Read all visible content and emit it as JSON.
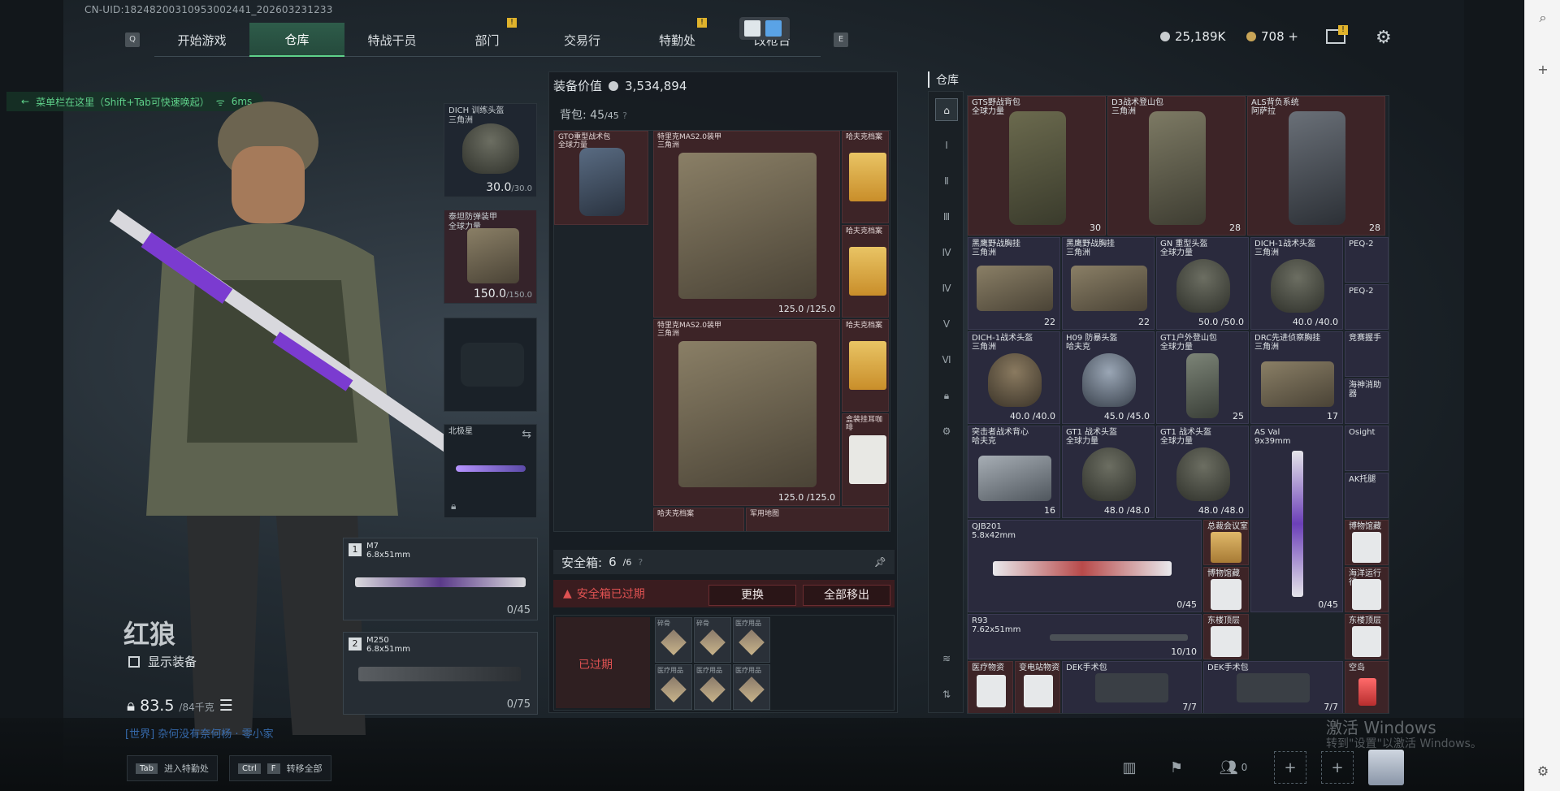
{
  "uid": "CN-UID:18248200310953002441_202603231233",
  "nav": {
    "left_key": "Q",
    "right_key": "E",
    "tabs": [
      {
        "label": "开始游戏",
        "alert": ""
      },
      {
        "label": "仓库",
        "alert": ""
      },
      {
        "label": "特战干员",
        "alert": ""
      },
      {
        "label": "部门",
        "alert": "!"
      },
      {
        "label": "交易行",
        "alert": ""
      },
      {
        "label": "特勤处",
        "alert": "!"
      },
      {
        "label": "改枪台",
        "alert": ""
      }
    ],
    "active_index": 1
  },
  "currency": {
    "silver": "25,189K",
    "gold": "708 +",
    "mail_alert": "!"
  },
  "menu_tip": {
    "text": "菜单栏在这里（Shift+Tab可快速唤起）",
    "ping": "6ms"
  },
  "character": {
    "name": "红狼",
    "show_equipment": "显示装备",
    "weight": "83.5",
    "weight_max": "/84千克",
    "world_msg": "[世界] 杂何没有奈何杨 · 零小家"
  },
  "equip_slots": {
    "helmet": {
      "label": "DICH 训练头盔",
      "sub": "三角洲",
      "dur": "30.0",
      "dur_max": "/30.0"
    },
    "armor": {
      "label": "泰坦防弹装甲",
      "sub": "全球力量",
      "dur": "150.0",
      "dur_max": "/150.0"
    },
    "knife": {
      "label": "北极星"
    },
    "primary": {
      "num": "1",
      "name": "M7",
      "caliber": "6.8x51mm",
      "ammo": "0/45"
    },
    "secondary": {
      "num": "2",
      "name": "M250",
      "caliber": "6.8x51mm",
      "ammo": "0/75"
    }
  },
  "equipment_value": {
    "label": "装备价值",
    "value": "3,534,894"
  },
  "backpack": {
    "label": "背包:",
    "used": "45",
    "max": "/45",
    "items": [
      {
        "label": "GTO重型战术包",
        "sub": "全球力量"
      },
      {
        "label": "特里克MAS2.0装甲",
        "sub": "三角洲",
        "dur": "125.0 /125.0"
      },
      {
        "label": "特里克MAS2.0装甲",
        "sub": "三角洲",
        "dur": "125.0 /125.0"
      },
      {
        "label": "哈夫克档案"
      },
      {
        "label": "哈夫克档案"
      },
      {
        "label": "哈夫克档案"
      },
      {
        "label": "盒装挂耳咖啡"
      },
      {
        "label": "哈夫克档案"
      },
      {
        "label": "军用地图"
      }
    ]
  },
  "safe": {
    "label": "安全箱:",
    "used": "6",
    "max": "/6",
    "expired": "安全箱已过期",
    "replace_btn": "更换",
    "move_all_btn": "全部移出",
    "box_expired": "已过期",
    "cells": [
      "碎骨",
      "碎骨",
      "医疗用品",
      "医疗用品",
      "医疗用品",
      "医疗用品"
    ]
  },
  "warehouse": {
    "title": "仓库",
    "items": [
      {
        "label": "GTS野战背包",
        "sub": "全球力量",
        "dur": "30"
      },
      {
        "label": "D3战术登山包",
        "sub": "三角洲",
        "dur": "28"
      },
      {
        "label": "ALS背负系统",
        "sub": "阿萨拉",
        "dur": "28"
      },
      {
        "label": "黑鹰野战胸挂",
        "sub": "三角洲",
        "dur": "22"
      },
      {
        "label": "黑鹰野战胸挂",
        "sub": "三角洲",
        "dur": "22"
      },
      {
        "label": "GN 重型头盔",
        "sub": "全球力量",
        "dur": "50.0 /50.0"
      },
      {
        "label": "DICH-1战术头盔",
        "sub": "三角洲",
        "dur": "40.0 /40.0"
      },
      {
        "label": "PEQ-2"
      },
      {
        "label": "PEQ-2"
      },
      {
        "label": "DICH-1战术头盔",
        "sub": "三角洲",
        "dur": "40.0 /40.0"
      },
      {
        "label": "H09 防暴头盔",
        "sub": "哈夫克",
        "dur": "45.0 /45.0"
      },
      {
        "label": "GT1户外登山包",
        "sub": "全球力量",
        "dur": "25"
      },
      {
        "label": "DRC先进侦察胸挂",
        "sub": "三角洲",
        "dur": "17"
      },
      {
        "label": "竞赛握手"
      },
      {
        "label": "海神消助器"
      },
      {
        "label": "突击者战术背心",
        "sub": "哈夫克",
        "dur": "16"
      },
      {
        "label": "GT1 战术头盔",
        "sub": "全球力量",
        "dur": "48.0 /48.0"
      },
      {
        "label": "GT1 战术头盔",
        "sub": "全球力量",
        "dur": "48.0 /48.0"
      },
      {
        "label": "AS Val",
        "sub": "9x39mm",
        "dur": "0/45"
      },
      {
        "label": "Osight"
      },
      {
        "label": "AK托腿"
      },
      {
        "label": "QJB201",
        "sub": "5.8x42mm",
        "dur": "0/45"
      },
      {
        "label": "总裁会议室"
      },
      {
        "label": "博物馆藏"
      },
      {
        "label": "博物馆藏"
      },
      {
        "label": "海洋运行行"
      },
      {
        "label": "R93",
        "sub": "7.62x51mm",
        "dur": "10/10"
      },
      {
        "label": "东楼顶层"
      },
      {
        "label": "东楼顶层"
      },
      {
        "label": "医疗物资"
      },
      {
        "label": "变电站物资"
      },
      {
        "label": "DEK手术包",
        "dur": "7/7"
      },
      {
        "label": "DEK手术包",
        "dur": "7/7"
      },
      {
        "label": "空岛"
      }
    ]
  },
  "hints": [
    {
      "keys": [
        "Tab"
      ],
      "text": "进入特勤处"
    },
    {
      "keys": [
        "Ctrl",
        "F"
      ],
      "text": "转移全部"
    }
  ],
  "watermark": {
    "line1": "激活 Windows",
    "line2": "转到\"设置\"以激活 Windows。"
  },
  "bottom": {
    "friends": "0",
    "stats_alert": "!"
  }
}
